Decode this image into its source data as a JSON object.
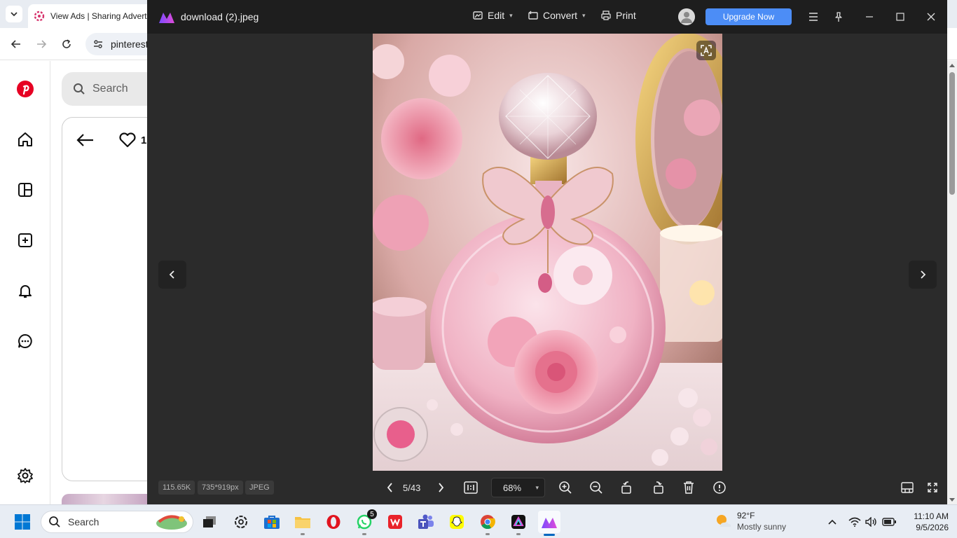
{
  "browser": {
    "tab_title": "View Ads | Sharing Advertis",
    "address": "pinterest",
    "pin_search_placeholder": "Search",
    "pin_like_count": "1"
  },
  "viewer": {
    "file_name": "download (2).jpeg",
    "menu": {
      "edit": "Edit",
      "convert": "Convert",
      "print": "Print"
    },
    "upgrade_label": "Upgrade Now",
    "info": {
      "size": "115.65K",
      "dimensions": "735*919px",
      "format": "JPEG"
    },
    "page_indicator": "5/43",
    "zoom": "68%",
    "accent": "#4c8df6"
  },
  "taskbar": {
    "search_placeholder": "Search",
    "whatsapp_badge": "5",
    "weather": {
      "temp": "92°F",
      "condition": "Mostly sunny"
    },
    "clock": {
      "time": "11:10 AM",
      "date": "9/5/2026"
    }
  }
}
